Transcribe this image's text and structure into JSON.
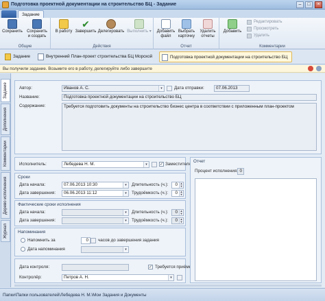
{
  "window": {
    "title": "Подготовка проектной документации на строительство БЦ - Задание"
  },
  "ribbon": {
    "file_tab": "",
    "tab": "Задание",
    "groups": {
      "general": "Общие",
      "actions": "Действия",
      "report": "Отчет",
      "comments": "Комментарии"
    },
    "buttons": {
      "save": "Сохранить",
      "save_create_1": "Сохранить",
      "save_create_2": "и создать",
      "to_work_1": "В работу",
      "complete": "Завершить",
      "delegate": "Делегировать",
      "execute": "Выполнить",
      "add_file_1": "Добавить",
      "add_file_2": "файл",
      "choose_card_1": "Выбрать",
      "choose_card_2": "карточку",
      "delete_reports_1": "Удалить",
      "delete_reports_2": "отчеты",
      "add_comment": "Добавить",
      "edit": "Редактировать",
      "view": "Просмотреть",
      "delete": "Удалить"
    }
  },
  "doc_tabs": [
    {
      "label": "Задание"
    },
    {
      "label": "Внутренний План-проект строительства БЦ Морской"
    },
    {
      "label": "Подготовка проектной документации на строительство БЦ"
    }
  ],
  "notice": {
    "text": "Вы получили задание. Возьмите его в работу, делегируйте либо завершите"
  },
  "side_tabs": [
    "Задание",
    "Дополнения",
    "Комментарии",
    "Дерево исполнения",
    "Журнал"
  ],
  "form": {
    "author_label": "Автор:",
    "author_value": "Иванов А. С.",
    "send_date_label": "Дата отправки:",
    "send_date_value": "07.06.2013",
    "name_label": "Название:",
    "name_value": "Подготовка проектной документации на строительство БЦ",
    "content_label": "Содержание:",
    "content_value": "Требуется подготовить документы на строительство бизнес центра в соответствии с приложенным план-проектом",
    "executor_label": "Исполнитель:",
    "executor_value": "Лебедева Н. М.",
    "deputy_label": "Заместителю",
    "terms_title": "Сроки",
    "start_date_label": "Дата начала:",
    "start_date_value": "07.06.2013 10:30",
    "end_date_label": "Дата завершения:",
    "end_date_value": "06.06.2013 11:12",
    "duration_label": "Длительность (ч.):",
    "duration_value": "0",
    "labor_label": "Трудоёмкость (ч.):",
    "labor_value": "0",
    "actual_title": "Фактические сроки исполнения",
    "fact_start_label": "Дата начала:",
    "fact_end_label": "Дата завершения:",
    "fact_duration_label": "Длительность (ч.):",
    "fact_duration_value": "0",
    "fact_labor_label": "Трудоёмкость (ч.):",
    "fact_labor_value": "0",
    "reminders_title": "Напоминания",
    "remind_before_label": "Напомнить за",
    "remind_before_value": "0",
    "remind_hours_label": "часов до завершения задания",
    "remind_date_label": "Дата напоминания",
    "control_date_label": "Дата контроля:",
    "acceptance_label": "Требуется приёмка",
    "controller_label": "Контролёр:",
    "controller_value": "Петров А. Н.",
    "report_title": "Отчет",
    "percent_label": "Процент исполнения:",
    "percent_value": "0"
  },
  "statusbar": {
    "path": "Папки\\Папки пользователей\\Лебедева Н. М.\\Мои Задания и Документы"
  }
}
